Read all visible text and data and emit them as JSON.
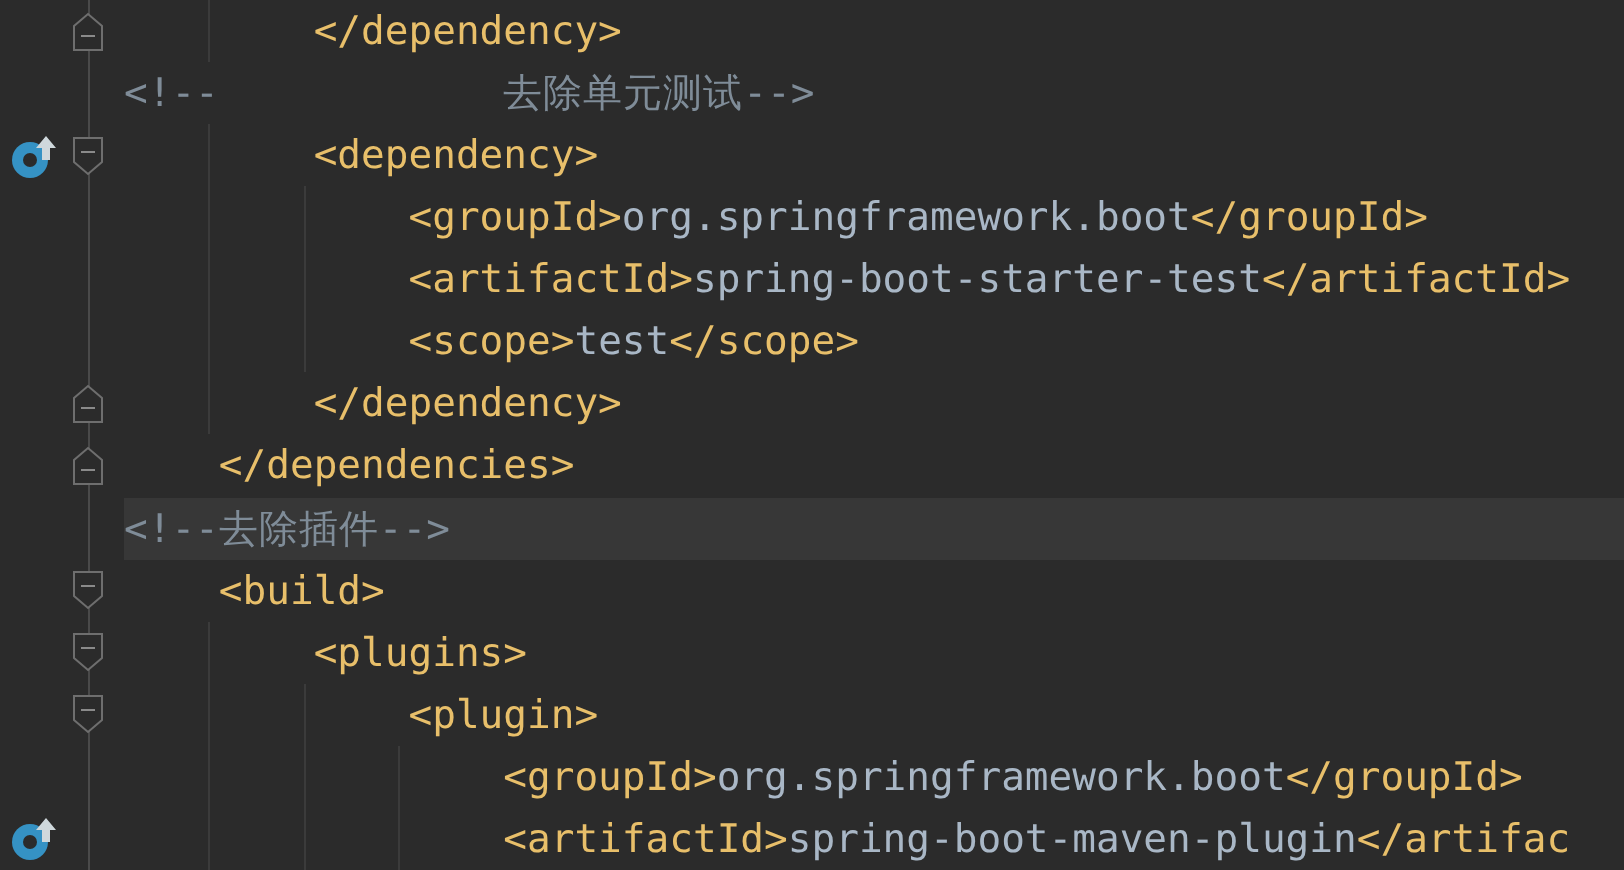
{
  "editor": {
    "lines": [
      {
        "kind": "close",
        "marker": false,
        "current": false,
        "segments": [
          {
            "kind": "tag",
            "text": "        </dependency>"
          }
        ]
      },
      {
        "kind": "plain",
        "marker": false,
        "current": false,
        "segments": [
          {
            "kind": "comment",
            "text": "<!--            去除单元测试-->"
          }
        ]
      },
      {
        "kind": "open",
        "marker": true,
        "current": false,
        "segments": [
          {
            "kind": "tag",
            "text": "        <dependency>"
          }
        ]
      },
      {
        "kind": "plain",
        "marker": false,
        "current": false,
        "segments": [
          {
            "kind": "tag",
            "text": "            <groupId>"
          },
          {
            "kind": "text",
            "text": "org.springframework.boot"
          },
          {
            "kind": "tag",
            "text": "</groupId>"
          }
        ]
      },
      {
        "kind": "plain",
        "marker": false,
        "current": false,
        "segments": [
          {
            "kind": "tag",
            "text": "            <artifactId>"
          },
          {
            "kind": "text",
            "text": "spring-boot-starter-test"
          },
          {
            "kind": "tag",
            "text": "</artifactId>"
          }
        ]
      },
      {
        "kind": "plain",
        "marker": false,
        "current": false,
        "segments": [
          {
            "kind": "tag",
            "text": "            <scope>"
          },
          {
            "kind": "text",
            "text": "test"
          },
          {
            "kind": "tag",
            "text": "</scope>"
          }
        ]
      },
      {
        "kind": "close",
        "marker": false,
        "current": false,
        "segments": [
          {
            "kind": "tag",
            "text": "        </dependency>"
          }
        ]
      },
      {
        "kind": "close",
        "marker": false,
        "current": false,
        "segments": [
          {
            "kind": "tag",
            "text": "    </dependencies>"
          }
        ]
      },
      {
        "kind": "plain",
        "marker": false,
        "current": true,
        "segments": [
          {
            "kind": "comment",
            "text": "<!--去除插件-->"
          }
        ]
      },
      {
        "kind": "open",
        "marker": false,
        "current": false,
        "segments": [
          {
            "kind": "tag",
            "text": "    <build>"
          }
        ]
      },
      {
        "kind": "open",
        "marker": false,
        "current": false,
        "segments": [
          {
            "kind": "tag",
            "text": "        <plugins>"
          }
        ]
      },
      {
        "kind": "open",
        "marker": false,
        "current": false,
        "segments": [
          {
            "kind": "tag",
            "text": "            <plugin>"
          }
        ]
      },
      {
        "kind": "plain",
        "marker": false,
        "current": false,
        "segments": [
          {
            "kind": "tag",
            "text": "                <groupId>"
          },
          {
            "kind": "text",
            "text": "org.springframework.boot"
          },
          {
            "kind": "tag",
            "text": "</groupId>"
          }
        ]
      },
      {
        "kind": "plain",
        "marker": true,
        "current": false,
        "segments": [
          {
            "kind": "tag",
            "text": "                <artifactId>"
          },
          {
            "kind": "text",
            "text": "spring-boot-maven-plugin"
          },
          {
            "kind": "tag",
            "text": "</artifac"
          }
        ]
      }
    ]
  }
}
